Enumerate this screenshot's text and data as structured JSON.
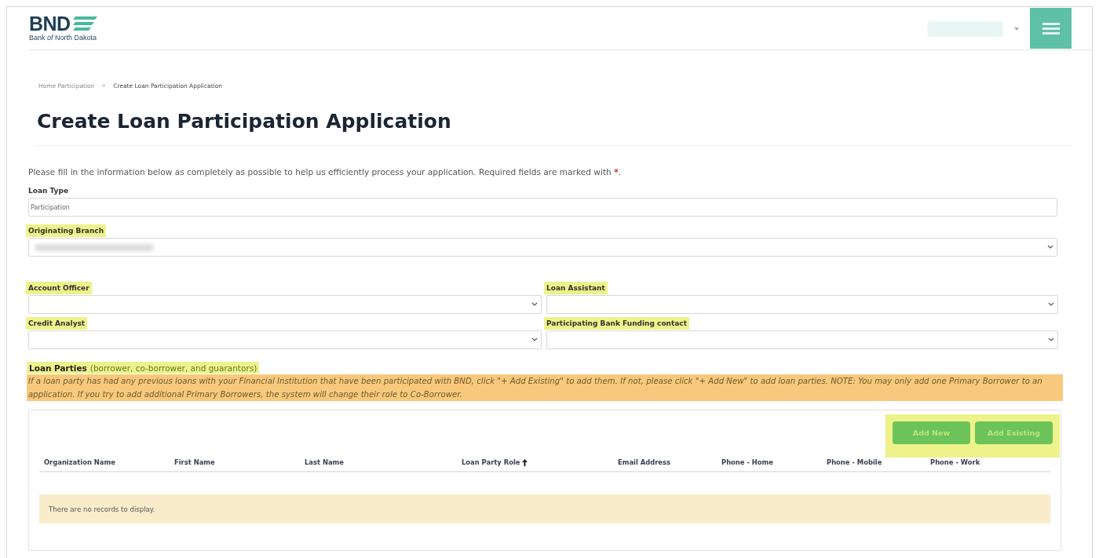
{
  "header": {
    "logo": {
      "wordmark": "BND",
      "tagline": "Bank *of* North Dakota"
    },
    "user_menu": {
      "redacted": true
    }
  },
  "breadcrumb": [
    {
      "label": "Home Participation",
      "current": false
    },
    {
      "label": ">",
      "kind": "separator"
    },
    {
      "label": "Create Loan Participation Application",
      "current": true
    }
  ],
  "title": "Create Loan Participation Application",
  "intro": {
    "text": "Please fill in the information below as completely as possible to help us efficiently process your application. Required fields are marked with ",
    "required_mark": "*",
    "end": "."
  },
  "fields": [
    {
      "label": "Loan Type",
      "kind": "text",
      "value": "Participation",
      "highlighted": false
    },
    {
      "label": "Originating Branch",
      "kind": "select",
      "redacted": true,
      "highlighted": true
    }
  ],
  "assignments": [
    {
      "label": "Account Officer",
      "highlighted": true
    },
    {
      "label": "Loan Assistant",
      "highlighted": true
    },
    {
      "label": "Credit Analyst",
      "highlighted": true
    },
    {
      "label": "Participating Bank Funding contact",
      "highlighted": true
    }
  ],
  "loan_parties": {
    "title": "Loan Parties",
    "subtitle": "(borrower, co-borrower, and guarantors)",
    "highlighted": true,
    "note": "If a loan party has had any previous loans with your Financial Institution that have been participated with BND, click \"+ Add Existing\" to add them. If not, please click \"+ Add New\" to add loan parties. NOTE: You may only add one Primary Borrower to an application. If you try to add additional Primary Borrowers, the system will change their role to Co-Borrower.",
    "note_highlighted": true,
    "buttons": [
      "Add New",
      "Add Existing"
    ],
    "buttons_highlighted": true,
    "table": {
      "columns": [
        {
          "label": "Organization Name",
          "sorted": false
        },
        {
          "label": "First Name",
          "sorted": false
        },
        {
          "label": "Last Name",
          "sorted": false
        },
        {
          "label": "Loan Party Role",
          "sorted": true
        },
        {
          "label": "Email Address",
          "sorted": false
        },
        {
          "label": "Phone - Home",
          "sorted": false
        },
        {
          "label": "Phone - Mobile",
          "sorted": false
        },
        {
          "label": "Phone - Work",
          "sorted": false
        }
      ],
      "empty_message": "There are no records to display."
    }
  }
}
